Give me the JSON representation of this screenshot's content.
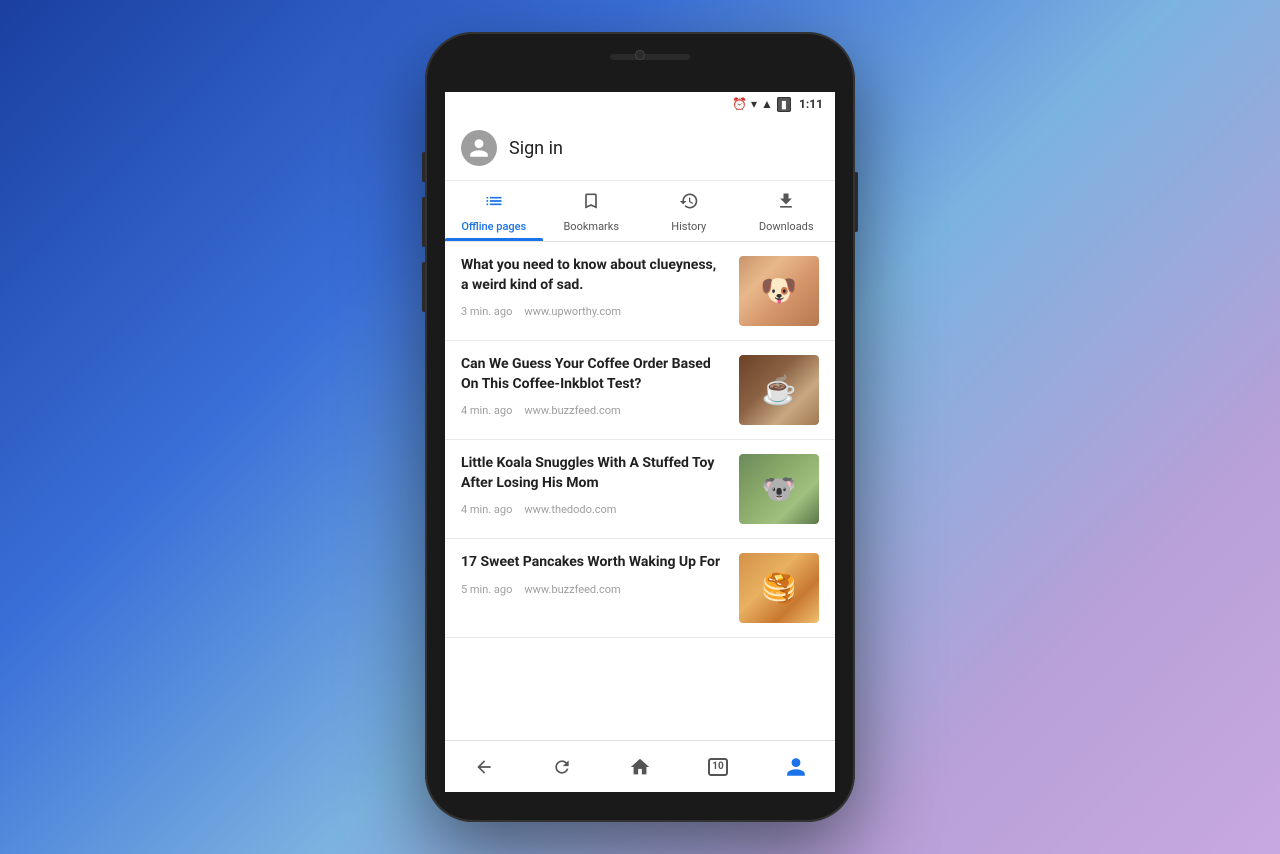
{
  "statusBar": {
    "time": "1:11",
    "icons": [
      "alarm",
      "wifi",
      "signal",
      "battery"
    ]
  },
  "header": {
    "signInLabel": "Sign in"
  },
  "tabs": [
    {
      "id": "offline",
      "label": "Offline pages",
      "active": true
    },
    {
      "id": "bookmarks",
      "label": "Bookmarks",
      "active": false
    },
    {
      "id": "history",
      "label": "History",
      "active": false
    },
    {
      "id": "downloads",
      "label": "Downloads",
      "active": false
    }
  ],
  "articles": [
    {
      "title": "What you need to know about clueyness, a weird kind of sad.",
      "timeAgo": "3 min. ago",
      "source": "www.upworthy.com",
      "thumbType": "dog"
    },
    {
      "title": "Can We Guess Your Coffee Order Based On This Coffee-Inkblot Test?",
      "timeAgo": "4 min. ago",
      "source": "www.buzzfeed.com",
      "thumbType": "coffee"
    },
    {
      "title": "Little Koala Snuggles With A Stuffed Toy After Losing His Mom",
      "timeAgo": "4 min. ago",
      "source": "www.thedodo.com",
      "thumbType": "koala"
    },
    {
      "title": "17 Sweet Pancakes Worth Waking Up For",
      "timeAgo": "5 min. ago",
      "source": "www.buzzfeed.com",
      "thumbType": "pancakes"
    }
  ],
  "bottomNav": {
    "tabsCount": "10"
  }
}
